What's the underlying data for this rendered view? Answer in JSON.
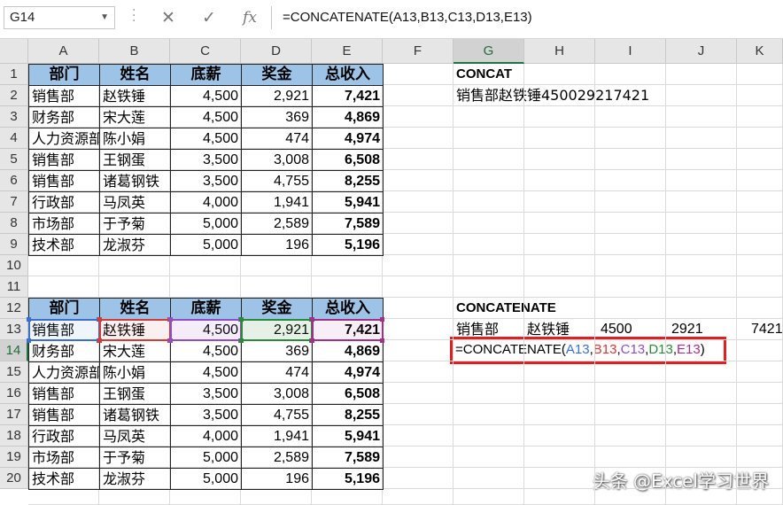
{
  "name_box": "G14",
  "formula_bar": "=CONCATENATE(A13,B13,C13,D13,E13)",
  "columns": [
    "A",
    "B",
    "C",
    "D",
    "E",
    "F",
    "G",
    "H",
    "I",
    "J",
    "K"
  ],
  "selected_column": "G",
  "rows": [
    "1",
    "2",
    "3",
    "4",
    "5",
    "6",
    "7",
    "8",
    "9",
    "10",
    "11",
    "12",
    "13",
    "14",
    "15",
    "16",
    "17",
    "18",
    "19",
    "20"
  ],
  "selected_row": "14",
  "table1": {
    "headers": [
      "部门",
      "姓名",
      "底薪",
      "奖金",
      "总收入"
    ],
    "rows": [
      [
        "销售部",
        "赵铁锤",
        "4,500",
        "2,921",
        "7,421"
      ],
      [
        "财务部",
        "宋大莲",
        "4,500",
        "369",
        "4,869"
      ],
      [
        "人力资源部",
        "陈小娟",
        "4,500",
        "474",
        "4,974"
      ],
      [
        "销售部",
        "王钢蛋",
        "3,500",
        "3,008",
        "6,508"
      ],
      [
        "销售部",
        "诸葛钢铁",
        "3,500",
        "4,755",
        "8,255"
      ],
      [
        "行政部",
        "马凤英",
        "4,000",
        "1,941",
        "5,941"
      ],
      [
        "市场部",
        "于予菊",
        "5,000",
        "2,589",
        "7,589"
      ],
      [
        "技术部",
        "龙淑芬",
        "5,000",
        "196",
        "5,196"
      ]
    ]
  },
  "table2": {
    "headers": [
      "部门",
      "姓名",
      "底薪",
      "奖金",
      "总收入"
    ],
    "rows": [
      [
        "销售部",
        "赵铁锤",
        "4,500",
        "2,921",
        "7,421"
      ],
      [
        "财务部",
        "宋大莲",
        "4,500",
        "369",
        "4,869"
      ],
      [
        "人力资源部",
        "陈小娟",
        "4,500",
        "474",
        "4,974"
      ],
      [
        "销售部",
        "王钢蛋",
        "3,500",
        "3,008",
        "6,508"
      ],
      [
        "销售部",
        "诸葛钢铁",
        "3,500",
        "4,755",
        "8,255"
      ],
      [
        "行政部",
        "马凤英",
        "4,000",
        "1,941",
        "5,941"
      ],
      [
        "市场部",
        "于予菊",
        "5,000",
        "2,589",
        "7,589"
      ],
      [
        "技术部",
        "龙淑芬",
        "5,000",
        "196",
        "5,196"
      ]
    ]
  },
  "concat": {
    "label": "CONCAT",
    "result": "销售部赵铁锤450029217421"
  },
  "concatenate": {
    "label": "CONCATENATE",
    "results": [
      "销售部",
      "赵铁锤",
      "4500",
      "2921",
      "7421"
    ],
    "formula_parts": [
      {
        "t": "=CONCATENATE(",
        "c": "#000000"
      },
      {
        "t": "A13",
        "c": "#3b6fcf"
      },
      {
        "t": ",",
        "c": "#000000"
      },
      {
        "t": "B13",
        "c": "#d03b3b"
      },
      {
        "t": ",",
        "c": "#000000"
      },
      {
        "t": "C13",
        "c": "#8f4fc2"
      },
      {
        "t": ",",
        "c": "#000000"
      },
      {
        "t": "D13",
        "c": "#2a8a3a"
      },
      {
        "t": ",",
        "c": "#000000"
      },
      {
        "t": "E13",
        "c": "#a0308a"
      },
      {
        "t": ")",
        "c": "#000000"
      }
    ]
  },
  "toolbar": {
    "cancel_icon": "cancel-x-icon",
    "enter_icon": "enter-check-icon",
    "fx": "fx"
  },
  "watermark": "头条 @Excel学习世界",
  "colors": {
    "header_fill": "#9dc3e6",
    "selection": "#217346",
    "highlight_box": "#e02020"
  }
}
